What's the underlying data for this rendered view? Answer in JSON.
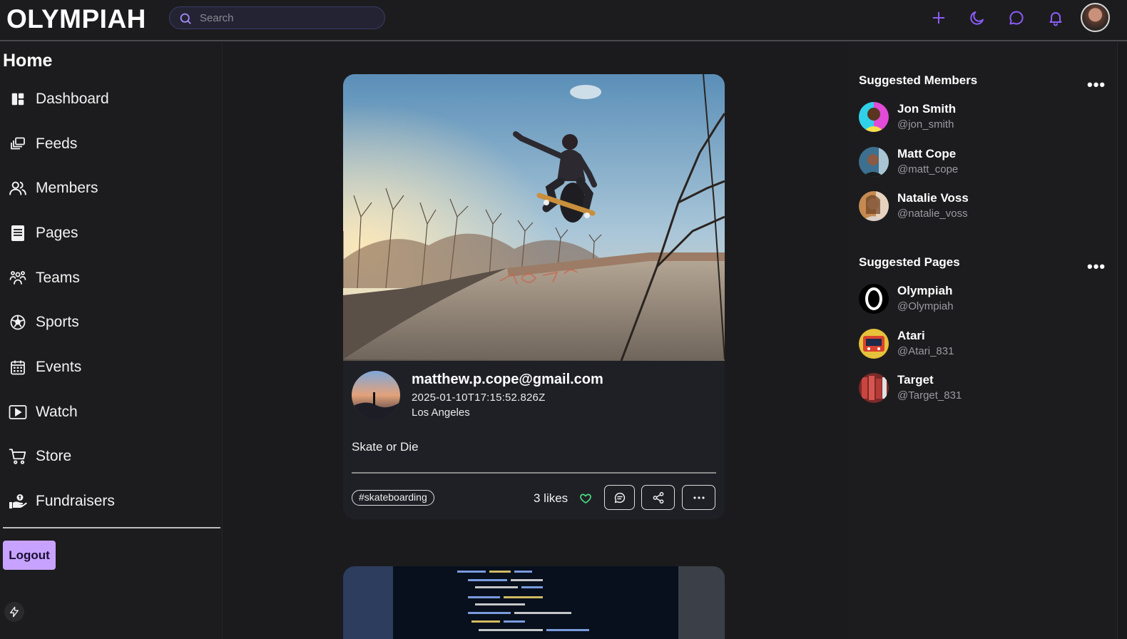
{
  "app": {
    "logo": "OLYMPIAH"
  },
  "search": {
    "placeholder": "Search"
  },
  "header_icons": [
    "plus-icon",
    "moon-icon",
    "chat-icon",
    "bell-icon"
  ],
  "accent_color": "#8b5cf6",
  "sidebar": {
    "title": "Home",
    "items": [
      {
        "label": "Dashboard",
        "icon": "dashboard-icon"
      },
      {
        "label": "Feeds",
        "icon": "feeds-icon"
      },
      {
        "label": "Members",
        "icon": "members-icon"
      },
      {
        "label": "Pages",
        "icon": "pages-icon"
      },
      {
        "label": "Teams",
        "icon": "teams-icon"
      },
      {
        "label": "Sports",
        "icon": "soccer-ball-icon"
      },
      {
        "label": "Events",
        "icon": "calendar-icon"
      },
      {
        "label": "Watch",
        "icon": "play-icon"
      },
      {
        "label": "Store",
        "icon": "cart-icon"
      },
      {
        "label": "Fundraisers",
        "icon": "donate-hand-icon"
      }
    ],
    "logout_label": "Logout"
  },
  "post": {
    "author_email": "matthew.p.cope@gmail.com",
    "timestamp": "2025-01-10T17:15:52.826Z",
    "location": "Los Angeles",
    "text": "Skate or Die",
    "hashtag": "#skateboarding",
    "likes_label": "3 likes"
  },
  "suggested_members": {
    "title": "Suggested Members",
    "more": "•••",
    "items": [
      {
        "name": "Jon Smith",
        "handle": "@jon_smith"
      },
      {
        "name": "Matt Cope",
        "handle": "@matt_cope"
      },
      {
        "name": "Natalie Voss",
        "handle": "@natalie_voss"
      }
    ]
  },
  "suggested_pages": {
    "title": "Suggested Pages",
    "more": "•••",
    "items": [
      {
        "name": "Olympiah",
        "handle": "@Olympiah"
      },
      {
        "name": "Atari",
        "handle": "@Atari_831"
      },
      {
        "name": "Target",
        "handle": "@Target_831"
      }
    ]
  }
}
